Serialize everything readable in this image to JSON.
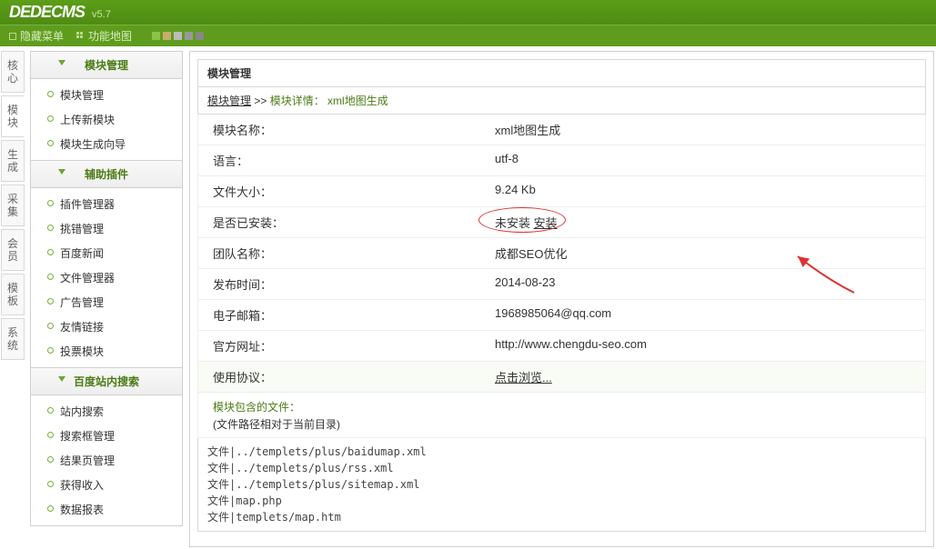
{
  "header": {
    "brand": "DEDECMS",
    "version": "v5.7"
  },
  "menubar": {
    "hide_menu": "隐藏菜单",
    "func_map": "功能地图"
  },
  "left_tabs": [
    "核心",
    "模块",
    "生成",
    "采集",
    "会员",
    "模板",
    "系统"
  ],
  "active_tab_index": 1,
  "sidebar": {
    "groups": [
      {
        "title": "模块管理",
        "items": [
          "模块管理",
          "上传新模块",
          "模块生成向导"
        ]
      },
      {
        "title": "辅助插件",
        "items": [
          "插件管理器",
          "挑错管理",
          "百度新闻",
          "文件管理器",
          "广告管理",
          "友情链接",
          "投票模块"
        ]
      },
      {
        "title": "百度站内搜索",
        "items": [
          "站内搜索",
          "搜索框管理",
          "结果页管理",
          "获得收入",
          "数据报表"
        ]
      }
    ]
  },
  "main": {
    "title": "模块管理",
    "crumb_root": "模块管理",
    "crumb_sep": " >> ",
    "crumb_leaf": "模块详情： xml地图生成",
    "rows": [
      {
        "k": "模块名称：",
        "v": "xml地图生成"
      },
      {
        "k": "语言：",
        "v": "utf-8"
      },
      {
        "k": "文件大小：",
        "v": "9.24 Kb"
      },
      {
        "k": "是否已安装：",
        "v_prefix": "未安装 ",
        "v_link": "安装",
        "circled": true
      },
      {
        "k": "团队名称：",
        "v": "成都SEO优化"
      },
      {
        "k": "发布时间：",
        "v": "2014-08-23"
      },
      {
        "k": "电子邮箱：",
        "v": "1968985064@qq.com"
      },
      {
        "k": "官方网址：",
        "v": "http://www.chengdu-seo.com"
      },
      {
        "k": "使用协议：",
        "v_link": "点击浏览..."
      }
    ],
    "files_label": "模块包含的文件：",
    "files_sublabel": "(文件路径相对于当前目录)",
    "files": [
      "文件|../templets/plus/baidumap.xml",
      "文件|../templets/plus/rss.xml",
      "文件|../templets/plus/sitemap.xml",
      "文件|map.php",
      "文件|templets/map.htm"
    ]
  }
}
